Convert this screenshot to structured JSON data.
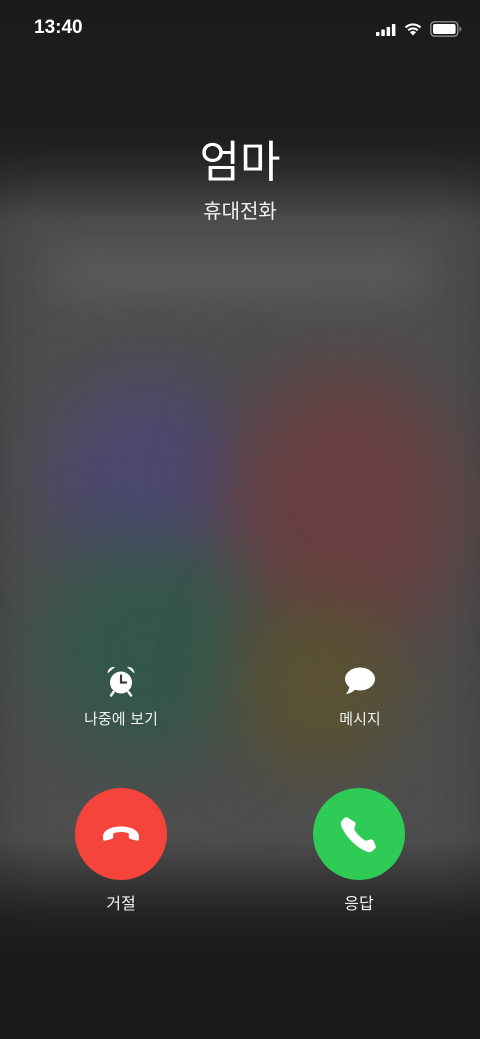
{
  "status_bar": {
    "time": "13:40",
    "signal_icon": "cellular-signal-icon",
    "wifi_icon": "wifi-icon",
    "battery_icon": "battery-full-icon"
  },
  "caller": {
    "name": "엄마",
    "label": "휴대전화"
  },
  "secondary_actions": {
    "remind": {
      "label": "나중에 보기",
      "icon": "alarm-clock-icon"
    },
    "message": {
      "label": "메시지",
      "icon": "message-bubble-icon"
    }
  },
  "call_actions": {
    "decline": {
      "label": "거절",
      "icon": "phone-hangup-icon",
      "color": "#f5443b"
    },
    "accept": {
      "label": "응답",
      "icon": "phone-icon",
      "color": "#2fcb57"
    }
  }
}
